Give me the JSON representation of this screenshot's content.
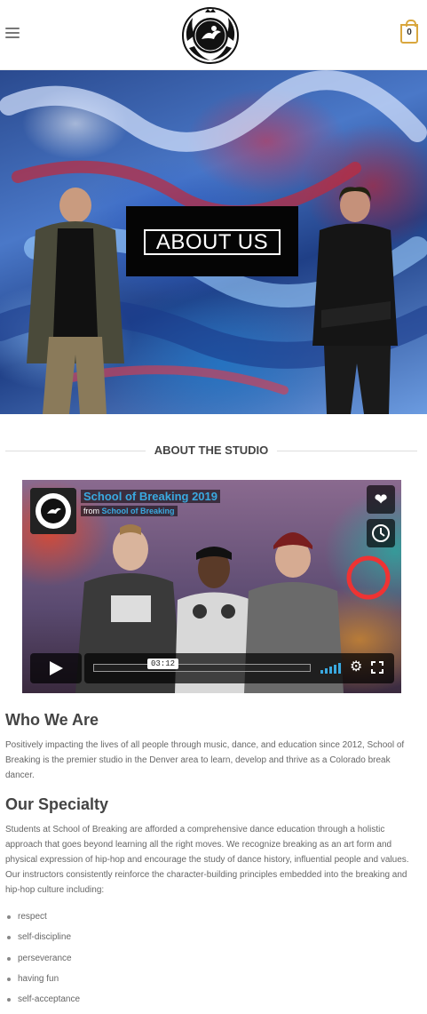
{
  "header": {
    "cart_count": "0"
  },
  "hero": {
    "banner_text": "ABOUT US"
  },
  "section": {
    "title": "ABOUT THE STUDIO"
  },
  "video": {
    "title": "School of Breaking 2019",
    "from_label": "from",
    "from_channel": "School of Breaking",
    "timestamp": "03:12",
    "accent": "#3aa9e0"
  },
  "who": {
    "heading": "Who We Are",
    "text": "Positively impacting the lives of all people through music, dance, and education since 2012, School of Breaking is the premier studio in the Denver area to learn, develop and thrive as a Colorado break dancer."
  },
  "specialty": {
    "heading": "Our Specialty",
    "text": "Students at School of Breaking are afforded a comprehensive dance education through a holistic approach that goes beyond learning all the right moves. We recognize breaking as an art form and physical expression of hip-hop and encourage the study of dance history, influential people and values. Our instructors consistently reinforce the character-building principles embedded into the breaking and hip-hop culture including:",
    "items": [
      "respect",
      "self-discipline",
      "perseverance",
      "having fun",
      "self-acceptance"
    ]
  }
}
